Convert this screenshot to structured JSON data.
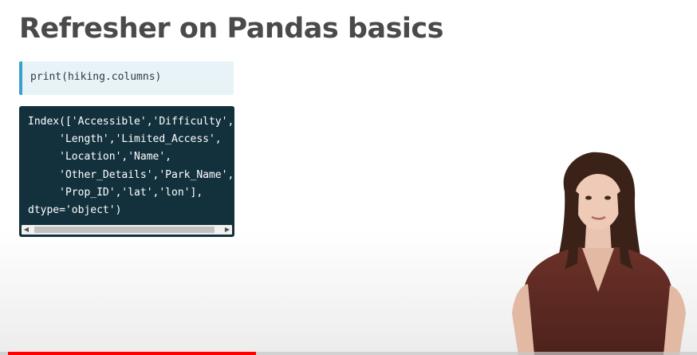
{
  "slide": {
    "title": "Refresher on Pandas basics"
  },
  "code_input": {
    "text": "print(hiking.columns)",
    "accent_color": "#3aa0cf"
  },
  "code_output": {
    "lines": [
      "Index(['Accessible','Difficulty',",
      "     'Length','Limited_Access',",
      "     'Location','Name',",
      "     'Other_Details','Park_Name',",
      "     'Prop_ID','lat','lon'],",
      "dtype='object')"
    ],
    "background": "#13313d"
  },
  "scrollbar": {
    "left_arrow": "◀",
    "right_arrow": "▶"
  },
  "video": {
    "progress_fraction": 0.36,
    "progress_color": "#ff0000"
  },
  "presenter": {
    "icon": "presenter-person"
  }
}
